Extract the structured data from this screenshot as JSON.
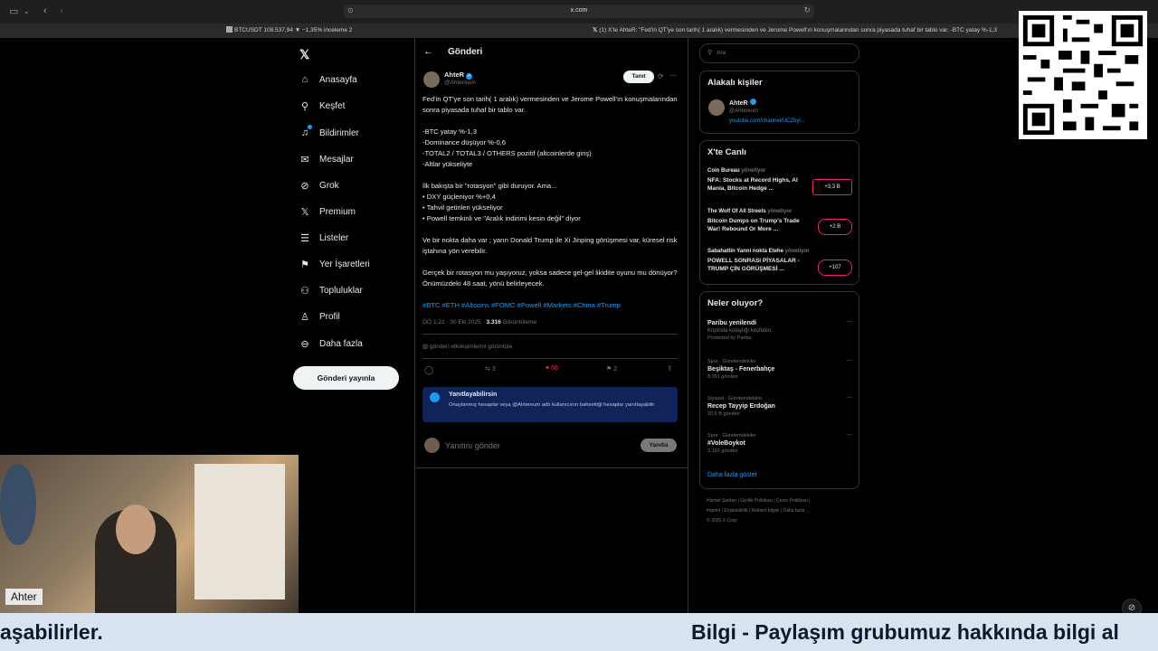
{
  "browser": {
    "url": "x.com",
    "tabs": [
      "BTCUSDT 108.537,94 ▼ −1,35% inceleme 2",
      "(1) X'te AhteR: \"Fed'in QT'ye son tarih( 1 aralık) vermesinden ve Jerome Powell'ın konuşmalarından sonra piyasada tuhaf bir tablo var. -BTC yatay %-1,3"
    ]
  },
  "nav": {
    "items": [
      {
        "label": "Anasayfa",
        "icon": "home-icon"
      },
      {
        "label": "Keşfet",
        "icon": "search-icon"
      },
      {
        "label": "Bildirimler",
        "icon": "bell-icon"
      },
      {
        "label": "Mesajlar",
        "icon": "mail-icon"
      },
      {
        "label": "Grok",
        "icon": "grok-icon"
      },
      {
        "label": "Premium",
        "icon": "x-icon"
      },
      {
        "label": "Listeler",
        "icon": "list-icon"
      },
      {
        "label": "Yer İşaretleri",
        "icon": "bookmark-icon"
      },
      {
        "label": "Topluluklar",
        "icon": "people-icon"
      },
      {
        "label": "Profil",
        "icon": "person-icon"
      },
      {
        "label": "Daha fazla",
        "icon": "more-circle-icon"
      }
    ],
    "post_button": "Gönderi yayınla"
  },
  "post": {
    "header": "Gönderi",
    "author_name": "AhteR",
    "author_handle": "@Ahtereum",
    "follow_btn": "Tanıt",
    "body": [
      "Fed'in QT'ye son tarih( 1 aralık) vermesinden ve Jerome Powell'ın konuşmalarından sonra piyasada tuhaf bir tablo var.",
      "-BTC yatay %-1,3\n-Dominance düşüyor %-0,6\n-TOTAL2 / TOTAL3 / OTHERS pozitif (altcoinlerde giriş)\n-Altlar yükseliyte",
      "İlk bakışta bir \"rotasyon\" gibi duruyor. Ama...\n• DXY güçleniyor %+0,4\n• Tahvil getirileri yükseliyor\n• Powell temkinli ve \"Aralık indirimi kesin değil\" diyor",
      "Ve bir nokta daha var ; yarın Donald Trump ile Xi Jinping görüşmesi var, küresel risk iştahına yön verebilir.",
      "Gerçek bir rotasyon mu yaşıyoruz, yoksa sadece gel-gel likidite oyunu mu dönüyor? Önümüzdeki 48 saat, yönü belirleyecek."
    ],
    "hashtags": "#BTC #ETH #Altcoins #FOMC #Powell #Markets #China #Trump",
    "time": "ÖÖ 1:22 · 30 Eki 2025 · ",
    "views_count": "3.316",
    "views_label": " Görüntüleme",
    "engagements": "gönderi etkileşimlerini görüntüle",
    "retweets": "3",
    "likes": "66",
    "bookmarks": "2",
    "reply_notice_title": "Yanıtlayabilirsin",
    "reply_notice_text": "Onaylanmış hesaplar veya @Ahtereum adlı kullanıcının bahsettiği hesaplar yanıtlayabilir",
    "reply_placeholder": "Yanıtını gönder",
    "reply_btn": "Yanıtla"
  },
  "sidebar": {
    "search_placeholder": "Ara",
    "related_title": "Alakalı kişiler",
    "related_name": "AhteR",
    "related_handle": "@Ahtereum",
    "related_link": "youtube.com/channel/UCZbyi...",
    "live_title": "X'te Canlı",
    "live": [
      {
        "host": "Coin Bureau",
        "role": "yönetiyor",
        "title": "NFA: Stocks at Record Highs, AI Mania, Bitcoin Hedge ...",
        "count": "+3,3 B"
      },
      {
        "host": "The Wolf Of All Streets",
        "role": "yönetiyor",
        "title": "Bitcoin Dumps on Trump's Trade War! Rebound Or More ...",
        "count": "+2 B"
      },
      {
        "host": "Sabahattin Yanni nokta Etehe",
        "role": "yönetiyor",
        "title": "POWELL SONRASI PİYASALAR - TRUMP ÇİN GÖRÜŞMESİ ...",
        "count": "+107"
      }
    ],
    "trends_title": "Neler oluyor?",
    "trends": [
      {
        "meta": "",
        "title": "Paribu yenilendi",
        "sub": "Kriptoda kolaylığı keşfedin.",
        "extra": "Promoted by Paribu"
      },
      {
        "meta": "Spor · Gündemdekiler",
        "title": "Beşiktaş - Fenerbahçe",
        "sub": "8.091 gönderi",
        "extra": ""
      },
      {
        "meta": "Siyaset · Gündemdekiler",
        "title": "Recep Tayyip Erdoğan",
        "sub": "20,6 B gönderi",
        "extra": ""
      },
      {
        "meta": "Spor · Gündemdekiler",
        "title": "#VoleBoykot",
        "sub": "3.192 gönderi",
        "extra": ""
      }
    ],
    "show_more": "Daha fazla göster",
    "footer1": "Hizmet Şartları | Gizlilik Politikası | Çerez Politikası |",
    "footer2": "Imprint | Erişilebilirlik | Reklam bilgisi | Daha fazla ...",
    "footer3": "© 2025 X Corp."
  },
  "overlay": {
    "webcam_name": "Ahter",
    "ticker_left": "aşabilirler.",
    "ticker_right": "Bilgi - Paylaşım grubumuz hakkında bilgi al"
  }
}
